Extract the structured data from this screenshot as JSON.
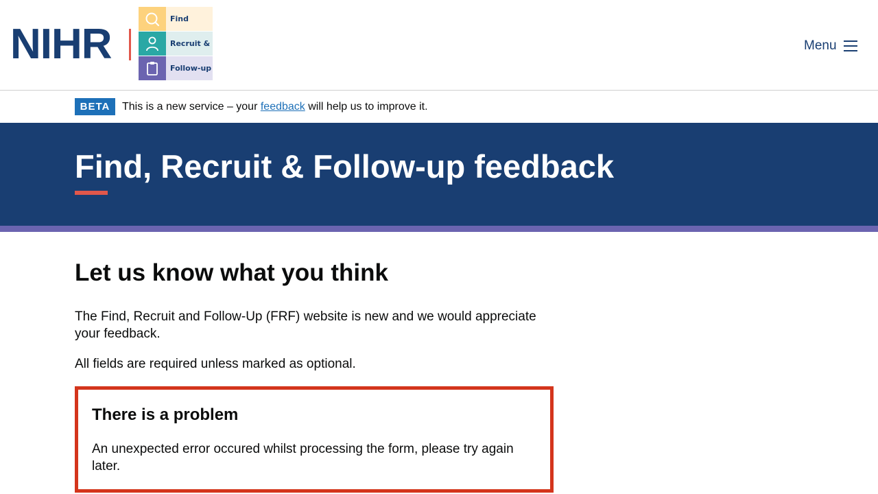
{
  "header": {
    "logo_text": "NIHR",
    "frf_logo": {
      "find": "Find",
      "recruit": "Recruit &",
      "follow_up": "Follow-up"
    },
    "menu_label": "Menu"
  },
  "beta": {
    "tag": "BETA",
    "text_before": "This is a new service – your",
    "link": "feedback",
    "text_after": "will help us to improve it."
  },
  "hero": {
    "title": "Find, Recruit & Follow-up feedback"
  },
  "main": {
    "heading": "Let us know what you think",
    "intro": "The Find, Recruit and Follow-Up (FRF) website is new and we would appreciate your feedback.",
    "required_note": "All fields are required unless marked as optional."
  },
  "error_summary": {
    "title": "There is a problem",
    "message": "An unexpected error occured whilst processing the form, please try again later."
  },
  "colors": {
    "brand_navy": "#193e72",
    "accent_coral": "#e1574b",
    "accent_purple": "#6b64b0",
    "link_blue": "#1d70b8",
    "error_red": "#d4351c"
  },
  "icons": [
    "search-icon",
    "person-icon",
    "clipboard-icon",
    "hamburger-icon"
  ]
}
